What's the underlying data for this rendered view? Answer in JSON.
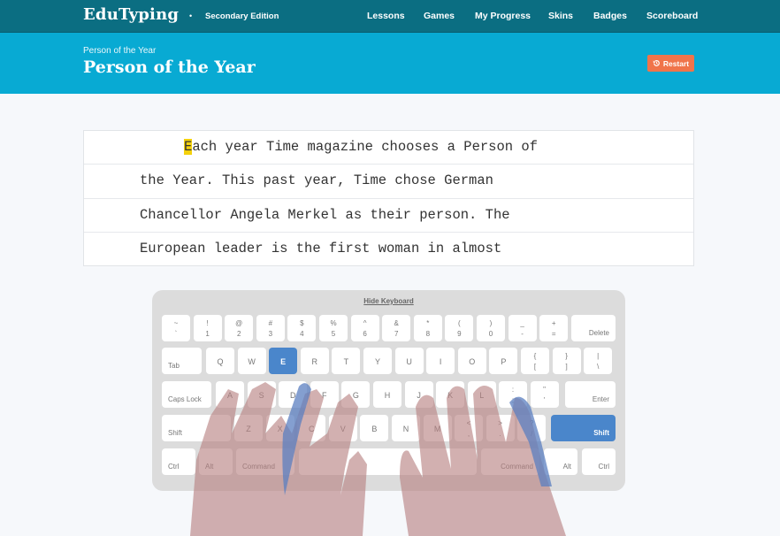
{
  "topnav": {
    "brand": "EduTyping",
    "separator": "•",
    "edition": "Secondary Edition",
    "links": [
      "Lessons",
      "Games",
      "My Progress",
      "Skins",
      "Badges",
      "Scoreboard"
    ]
  },
  "banner": {
    "breadcrumb": "Person of the Year",
    "title": "Person of the Year",
    "restart_label": "Restart",
    "restart_icon": "restart-icon"
  },
  "passage": {
    "current_char": "E",
    "lines": [
      "ach year Time magazine chooses a Person of",
      "the Year. This past year, Time chose German",
      "Chancellor Angela Merkel as their person. The",
      "European leader is the first woman in almost"
    ]
  },
  "keyboard": {
    "hide_label": "Hide Keyboard",
    "active_keys": [
      "E",
      "Shift-right"
    ],
    "colors": {
      "active": "#4a86cb",
      "finger_highlight": "#5b7fc0",
      "hand": "#c99a9a"
    },
    "row1": [
      {
        "top": "~",
        "bot": "`"
      },
      {
        "top": "!",
        "bot": "1"
      },
      {
        "top": "@",
        "bot": "2"
      },
      {
        "top": "#",
        "bot": "3"
      },
      {
        "top": "$",
        "bot": "4"
      },
      {
        "top": "%",
        "bot": "5"
      },
      {
        "top": "^",
        "bot": "6"
      },
      {
        "top": "&",
        "bot": "7"
      },
      {
        "top": "*",
        "bot": "8"
      },
      {
        "top": "(",
        "bot": "9"
      },
      {
        "top": ")",
        "bot": "0"
      },
      {
        "top": "_",
        "bot": "-"
      },
      {
        "top": "+",
        "bot": "="
      }
    ],
    "delete": "Delete",
    "tab": "Tab",
    "row2": [
      "Q",
      "W",
      "E",
      "R",
      "T",
      "Y",
      "U",
      "I",
      "O",
      "P"
    ],
    "row2_sym": [
      {
        "top": "{",
        "bot": "["
      },
      {
        "top": "}",
        "bot": "]"
      },
      {
        "top": "|",
        "bot": "\\"
      }
    ],
    "caps": "Caps Lock",
    "row3": [
      "A",
      "S",
      "D",
      "F",
      "G",
      "H",
      "J",
      "K",
      "L"
    ],
    "row3_sym": [
      {
        "top": ":",
        "bot": ";"
      },
      {
        "top": "\"",
        "bot": "'"
      }
    ],
    "enter": "Enter",
    "shift": "Shift",
    "row4": [
      "Z",
      "X",
      "C",
      "V",
      "B",
      "N",
      "M"
    ],
    "row4_sym": [
      {
        "top": "<",
        "bot": ","
      },
      {
        "top": ">",
        "bot": "."
      },
      {
        "top": "?",
        "bot": "/"
      }
    ],
    "ctrl": "Ctrl",
    "alt": "Alt",
    "command": "Command"
  }
}
